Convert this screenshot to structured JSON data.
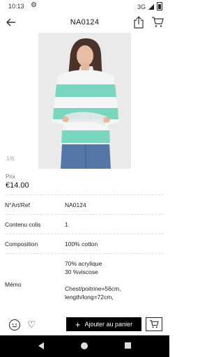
{
  "status": {
    "time": "10:13",
    "network": "3G"
  },
  "header": {
    "title": "NA0124"
  },
  "gallery": {
    "pager": "1/6"
  },
  "price": {
    "label": "Prix",
    "value": "€14.00"
  },
  "details": [
    {
      "label": "N°Art/Ref",
      "value": "NA0124"
    },
    {
      "label": "Contenu colis",
      "value": "1"
    },
    {
      "label": "Composition",
      "value": "100% cotton"
    }
  ],
  "memo": {
    "label": "Mémo",
    "lines": [
      "70% acrylique",
      "30 %viscose",
      "",
      "Chest/poitrine=56cm,",
      "length/long=72cm,"
    ]
  },
  "actions": {
    "add_to_cart": "Ajouter au panier"
  },
  "colors": {
    "accent": "#000000",
    "sweater_mint": "#7ad7bf",
    "background": "#ffffff"
  }
}
